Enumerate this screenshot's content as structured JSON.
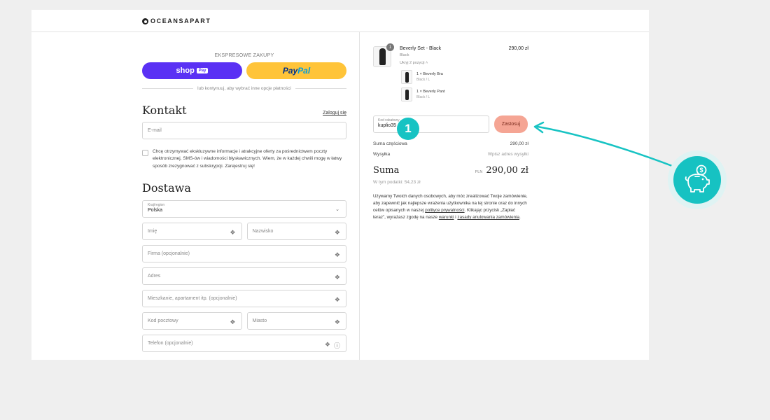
{
  "header": {
    "logo": "OCEANSAPART"
  },
  "left": {
    "express_label": "EKSPRESOWE ZAKUPY",
    "shop_label": "shop",
    "shop_badge": "Pay",
    "paypal_part1": "Pay",
    "paypal_part2": "Pal",
    "or_text": "lub kontynuuj, aby wybrać inne opcje płatności",
    "contact": {
      "title": "Kontakt",
      "login_link": "Zaloguj się",
      "email_placeholder": "E-mail",
      "newsletter_text": "Chcę otrzymywać ekskluzywne informacje i atrakcyjne oferty za pośrednictwem poczty elektronicznej, SMS-ów i wiadomości błyskawicznych. Wiem, że w każdej chwili mogę w łatwy sposób zrezygnować z subskrypcji. Zarejestruj się!"
    },
    "delivery": {
      "title": "Dostawa",
      "country_label": "Kraj/region",
      "country_value": "Polska",
      "first_name": "Imię",
      "last_name": "Nazwisko",
      "company": "Firma (opcjonalnie)",
      "address": "Adres",
      "apartment": "Mieszkanie, apartament itp. (opcjonalnie)",
      "postal_code": "Kod pocztowy",
      "city": "Miasto",
      "phone": "Telefon (opcjonalnie)"
    }
  },
  "right": {
    "item": {
      "qty": "1",
      "name": "Beverly Set - Black",
      "variant": "Black",
      "toggle": "Ukryj 2 pozycji",
      "price": "290,00 zł",
      "sub_items": [
        {
          "name": "1 × Beverly Bra",
          "variant": "Black / L"
        },
        {
          "name": "1 × Beverly Pant",
          "variant": "Black / L"
        }
      ]
    },
    "discount": {
      "label": "Kod rabatowy",
      "value": "kuplio35",
      "apply_label": "Zastosuj"
    },
    "subtotal": {
      "label": "Suma częściowa",
      "value": "290,00 zł"
    },
    "shipping": {
      "label": "Wysyłka",
      "value": "Wpisz adres wysyłki"
    },
    "total": {
      "label": "Suma",
      "currency": "PLN",
      "value": "290,00 zł"
    },
    "tax_line": "W tym podatki: 54,23 zł",
    "privacy": {
      "text1": "Używamy Twoich danych osobowych, aby móc zrealizować Twoje zamówienie, aby zapewnić jak najlepsze wrażenia użytkownika na tej stronie oraz do innych celów opisanych w naszej ",
      "link1": "polityce prywatności",
      "text2": ". Klikając przycisk „Zapłać teraz”, wyrażasz zgodę na nasze ",
      "link2": "warunki",
      "text3": " i ",
      "link3": "zasady anulowania zamówienia",
      "text4": "."
    }
  },
  "overlay": {
    "step_number": "1",
    "accent": "#17c3c3"
  }
}
